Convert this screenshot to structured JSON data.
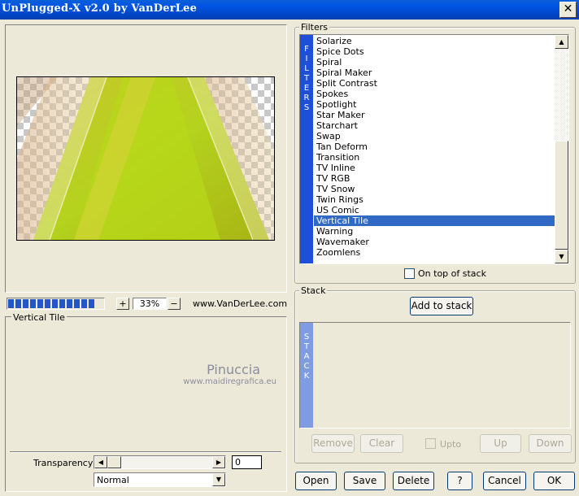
{
  "window": {
    "title": "UnPlugged-X v2.0 by VanDerLee",
    "close_icon": "✕"
  },
  "zoom": {
    "plus": "+",
    "value": "33%",
    "minus": "−",
    "progress_segments": 12
  },
  "website": "www.VanDerLee.com",
  "params": {
    "group_label": "Vertical Tile",
    "watermark_line1": "Pinuccia",
    "watermark_line2": "www.maidiregrafica.eu",
    "transparency_label": "Transparency",
    "transparency_value": "0",
    "blend_mode": "Normal"
  },
  "filters": {
    "group_label": "Filters",
    "strip_text": "FILTERS",
    "items": [
      "Solarize",
      "Spice Dots",
      "Spiral",
      "Spiral Maker",
      "Split Contrast",
      "Spokes",
      "Spotlight",
      "Star Maker",
      "Starchart",
      "Swap",
      "Tan Deform",
      "Transition",
      "TV Inline",
      "TV RGB",
      "TV Snow",
      "Twin Rings",
      "US Comic",
      "Vertical Tile",
      "Warning",
      "Wavemaker",
      "Zoomlens"
    ],
    "selected": "Vertical Tile",
    "on_top_label": "On top of stack"
  },
  "stack": {
    "group_label": "Stack",
    "add_label": "Add to stack",
    "strip_text": "STACK",
    "remove_label": "Remove",
    "clear_label": "Clear",
    "upto_label": "Upto",
    "up_label": "Up",
    "down_label": "Down"
  },
  "footer": {
    "open": "Open",
    "save": "Save",
    "delete": "Delete",
    "help": "?",
    "cancel": "Cancel",
    "ok": "OK"
  },
  "colors": {
    "titlebar": "#0055e5",
    "accent": "#316ac5",
    "filter_strip": "#1f4fd8",
    "stack_strip": "#7f9ce0"
  }
}
